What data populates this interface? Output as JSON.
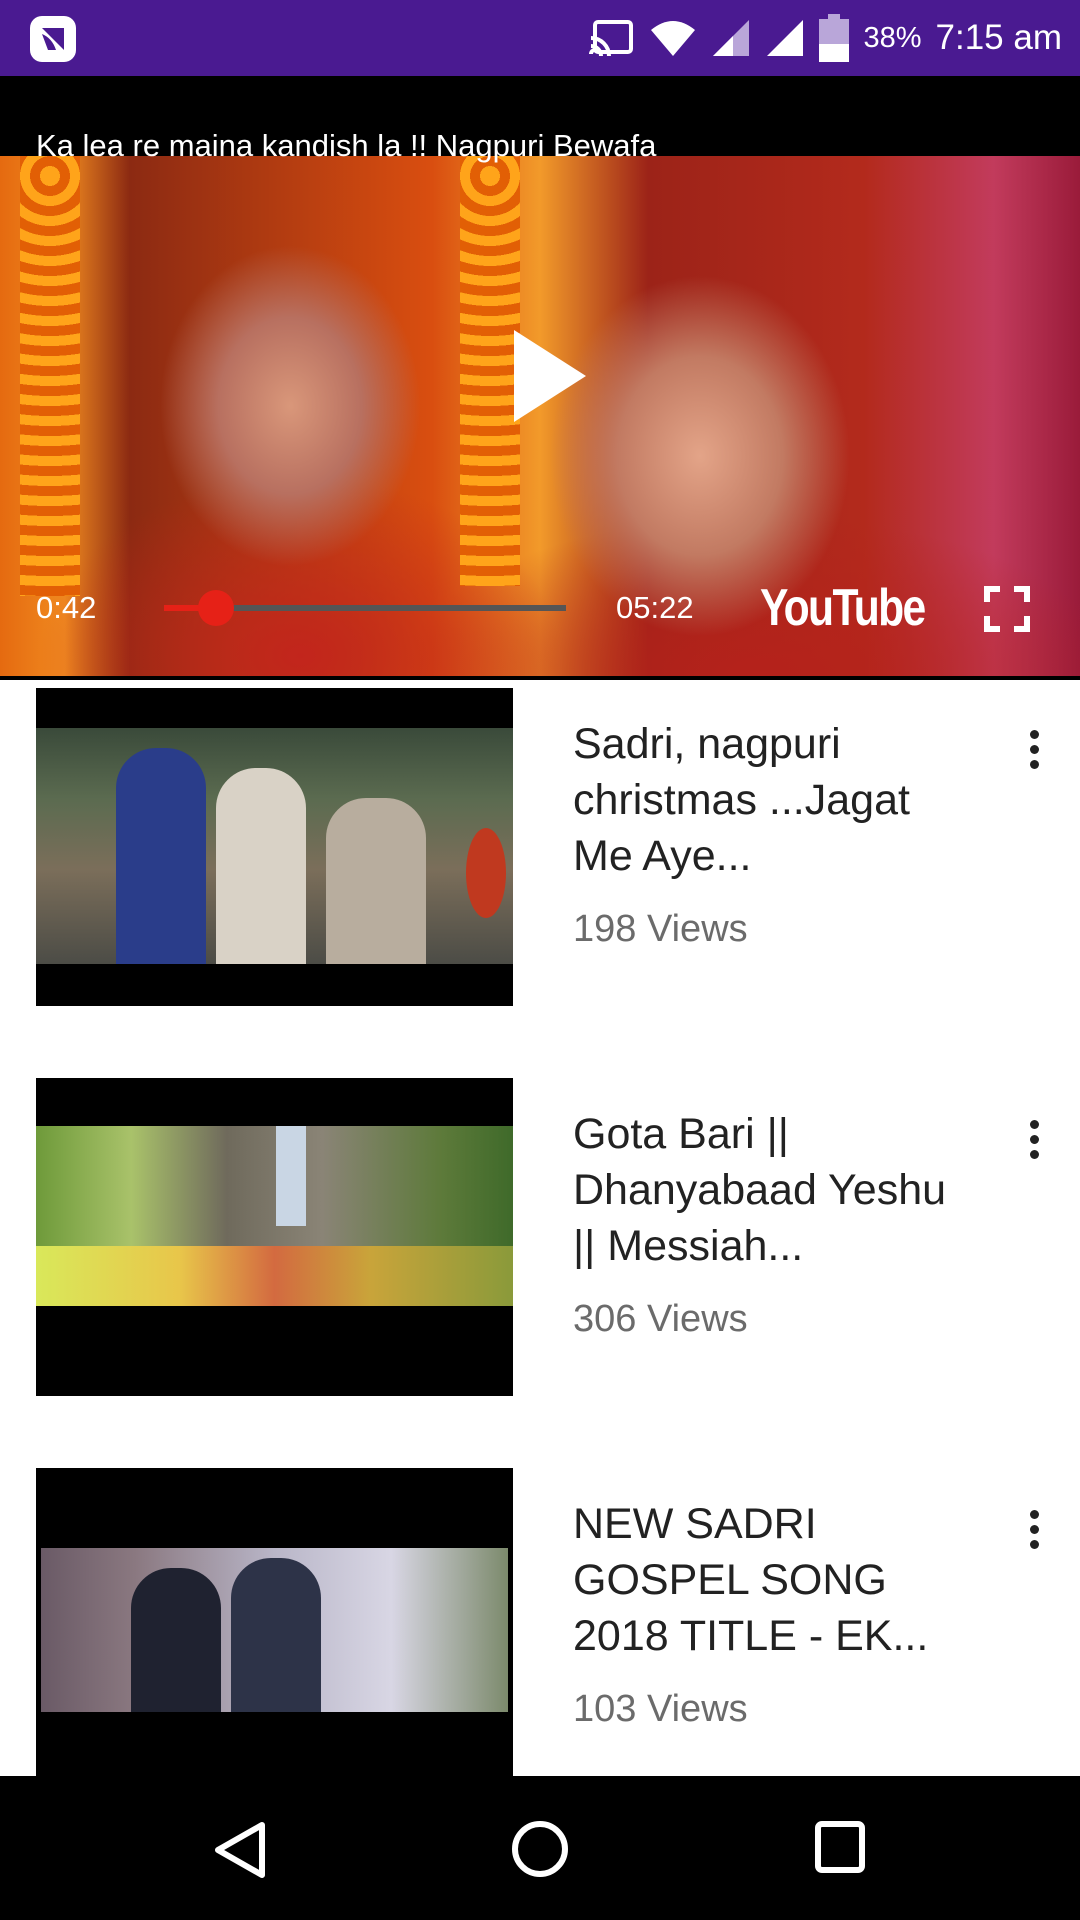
{
  "status_bar": {
    "battery_percent": "38%",
    "time": "7:15 am",
    "background": "#4a1a91",
    "icons": [
      "app-icon",
      "cast-icon",
      "wifi-icon",
      "signal-icon",
      "signal-icon",
      "battery-icon"
    ]
  },
  "player": {
    "title": "Ka lea re maina kandish la !! Nagpuri Bewafa",
    "current_time": "0:42",
    "total_time": "05:22",
    "progress_fraction": 0.13,
    "logo": "YouTube",
    "accent": "#e62117",
    "icons": [
      "play-icon",
      "fullscreen-icon"
    ]
  },
  "videos": [
    {
      "title": "Sadri, nagpuri christmas ...Jagat Me Aye...",
      "views": "198 Views"
    },
    {
      "title": "Gota Bari || Dhanyabaad Yeshu || Messiah...",
      "views": "306 Views"
    },
    {
      "title": "NEW SADRI GOSPEL SONG 2018 TITLE - EK...",
      "views": "103 Views"
    }
  ],
  "nav_bar": {
    "icons": [
      "back-icon",
      "home-icon",
      "recents-icon"
    ]
  }
}
